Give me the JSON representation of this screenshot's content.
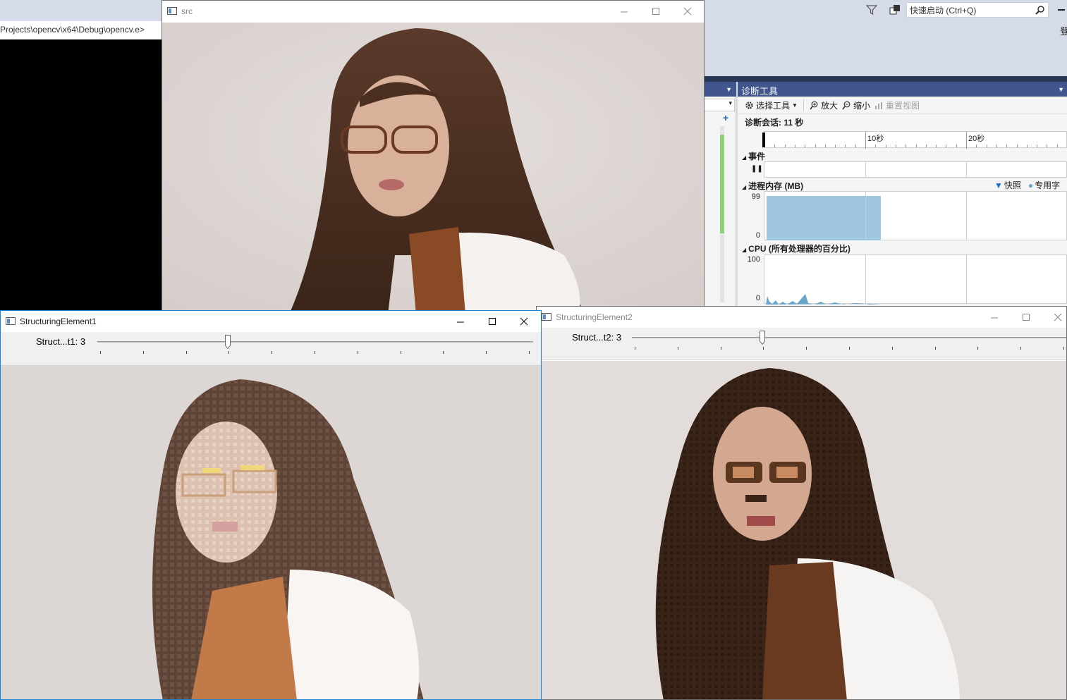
{
  "vs": {
    "quick_launch_placeholder": "快速启动 (Ctrl+Q)",
    "side_char": "登",
    "console_path": "Projects\\opencv\\x64\\Debug\\opencv.e>",
    "out_combo": "▾",
    "diag": {
      "title": "诊断工具",
      "toolbar": {
        "select_tool": "选择工具",
        "zoom_in": "放大",
        "zoom_out": "缩小",
        "reset_view": "重置视图"
      },
      "session": "诊断会话: 11 秒",
      "timeline_labels": [
        "10秒",
        "20秒"
      ],
      "events_label": "事件",
      "memory_label": "进程内存 (MB)",
      "memory_max": "99",
      "memory_min": "0",
      "legend": [
        "快照",
        "专用字"
      ],
      "cpu_label": "CPU (所有处理器的百分比)",
      "cpu_max": "100",
      "cpu_min": "0",
      "memory_fill_fraction": 0.38
    }
  },
  "windows": {
    "src": {
      "title": "src"
    },
    "se1": {
      "title": "StructuringElement1",
      "trackbar_label": "Struct...t1: 3",
      "trackbar_value": 3,
      "trackbar_max": 10
    },
    "se2": {
      "title": "StructuringElement2",
      "trackbar_label": "Struct...t2: 3",
      "trackbar_value": 3,
      "trackbar_max": 10
    }
  },
  "colors": {
    "vs_accent": "#40568d",
    "vs_dark": "#293955",
    "memory_fill": "#9ec6de",
    "cpu_fill": "#6aa6c9"
  }
}
